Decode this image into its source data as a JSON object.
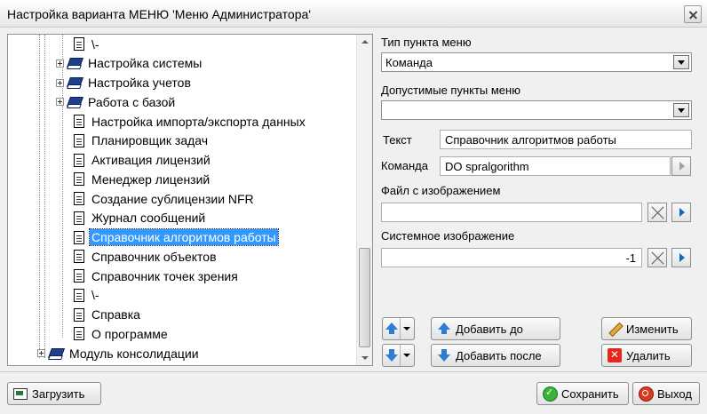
{
  "window": {
    "title": "Настройка варианта МЕНЮ 'Меню Администратора'"
  },
  "tree": {
    "items": [
      {
        "label": "\\-",
        "icon": "document-icon",
        "expandable": false
      },
      {
        "label": "Настройка системы",
        "icon": "book-icon",
        "expandable": true
      },
      {
        "label": "Настройка учетов",
        "icon": "book-icon",
        "expandable": true
      },
      {
        "label": "Работа с базой",
        "icon": "book-icon",
        "expandable": true
      },
      {
        "label": "Настройка импорта/экспорта данных",
        "icon": "document-icon",
        "expandable": false
      },
      {
        "label": "Планировщик задач",
        "icon": "document-icon",
        "expandable": false
      },
      {
        "label": "Активация лицензий",
        "icon": "document-icon",
        "expandable": false
      },
      {
        "label": "Менеджер лицензий",
        "icon": "document-icon",
        "expandable": false
      },
      {
        "label": "Создание сублицензии NFR",
        "icon": "document-icon",
        "expandable": false
      },
      {
        "label": "Журнал сообщений",
        "icon": "document-icon",
        "expandable": false
      },
      {
        "label": "Справочник алгоритмов работы",
        "icon": "document-icon",
        "expandable": false,
        "selected": true
      },
      {
        "label": "Справочник объектов",
        "icon": "document-icon",
        "expandable": false
      },
      {
        "label": "Справочник точек зрения",
        "icon": "document-icon",
        "expandable": false
      },
      {
        "label": "\\-",
        "icon": "document-icon",
        "expandable": false
      },
      {
        "label": "Справка",
        "icon": "document-icon",
        "expandable": false
      },
      {
        "label": "О программе",
        "icon": "document-icon",
        "expandable": false
      },
      {
        "label": "Модуль консолидации",
        "icon": "book-icon",
        "expandable": true
      }
    ]
  },
  "form": {
    "menu_item_type_label": "Тип пункта меню",
    "menu_item_type_value": "Команда",
    "allowed_items_label": "Допустимые пункты меню",
    "allowed_items_value": "",
    "text_label": "Текст",
    "text_value": "Справочник алгоритмов работы",
    "command_label": "Команда",
    "command_value": "DO spralgorithm",
    "image_file_label": "Файл с изображением",
    "image_file_value": "",
    "system_image_label": "Системное изображение",
    "system_image_value": "-1"
  },
  "buttons": {
    "add_before": "Добавить до",
    "add_after": "Добавить после",
    "edit": "Изменить",
    "delete": "Удалить",
    "load": "Загрузить",
    "save": "Сохранить",
    "exit": "Выход"
  }
}
